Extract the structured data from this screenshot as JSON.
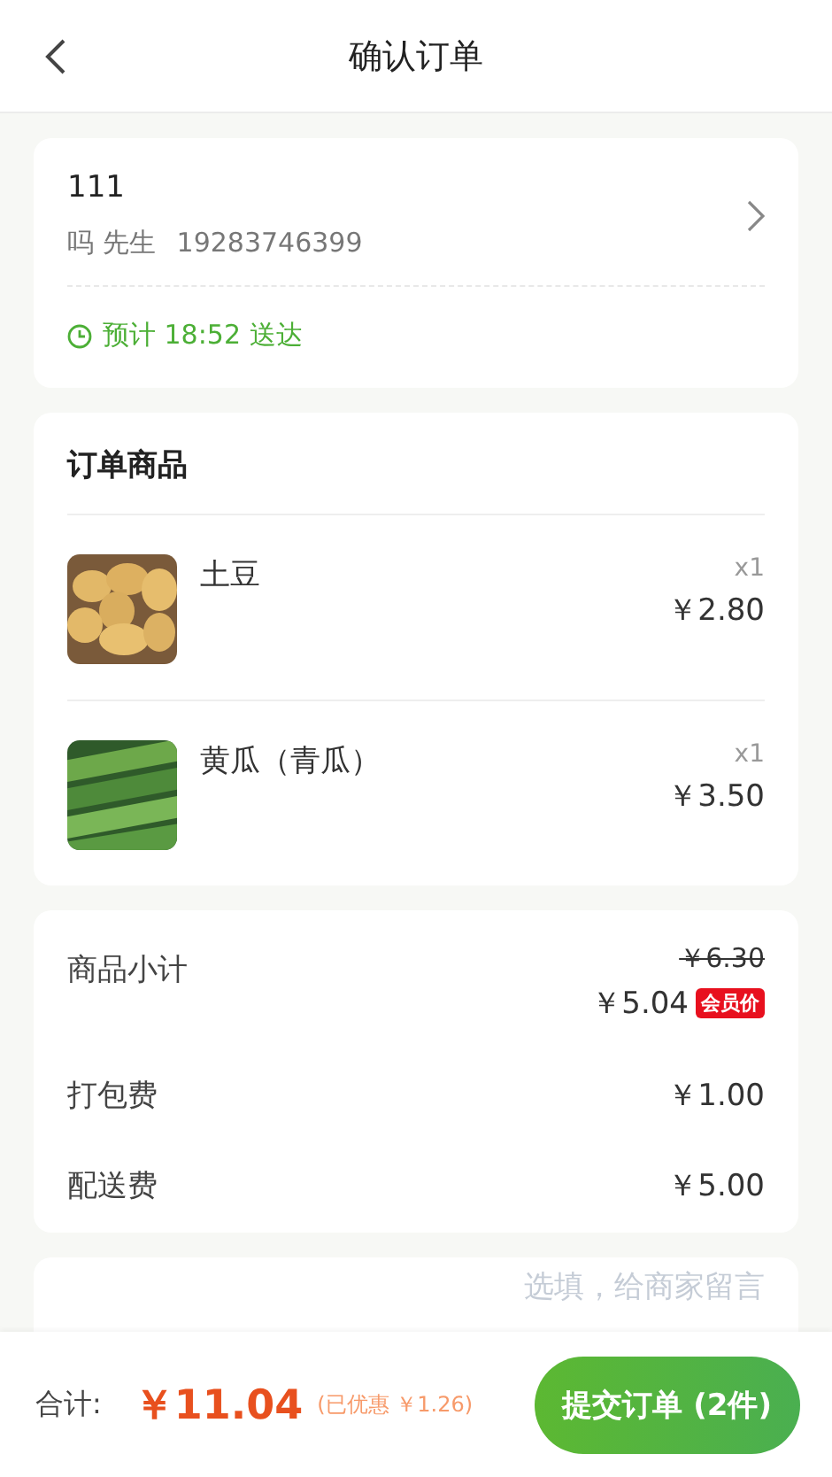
{
  "header": {
    "title": "确认订单"
  },
  "address": {
    "line": "111",
    "contact": "吗 先生",
    "phone": "19283746399",
    "delivery": "预计 18:52 送达"
  },
  "goods": {
    "title": "订单商品",
    "items": [
      {
        "name": "土豆",
        "qty": "x1",
        "price": "￥2.80",
        "kind": "picture"
      },
      {
        "name": "黄瓜（青瓜）",
        "qty": "x1",
        "price": "￥3.50",
        "kind": "picture"
      }
    ]
  },
  "fees": [
    {
      "kind": "discounted",
      "label": "商品小计",
      "original": "￥6.30",
      "price": "￥5.04",
      "badge": "会员价"
    },
    {
      "kind": "plain",
      "label": "打包费",
      "price": "￥1.00"
    },
    {
      "kind": "plain",
      "label": "配送费",
      "price": "￥5.00"
    }
  ],
  "remark": {
    "placeholder": "选填，给商家留言"
  },
  "footer": {
    "label": "合计:",
    "total": "￥11.04",
    "saved": "(已优惠 ￥1.26)",
    "submit": "提交订单 (2件)"
  }
}
